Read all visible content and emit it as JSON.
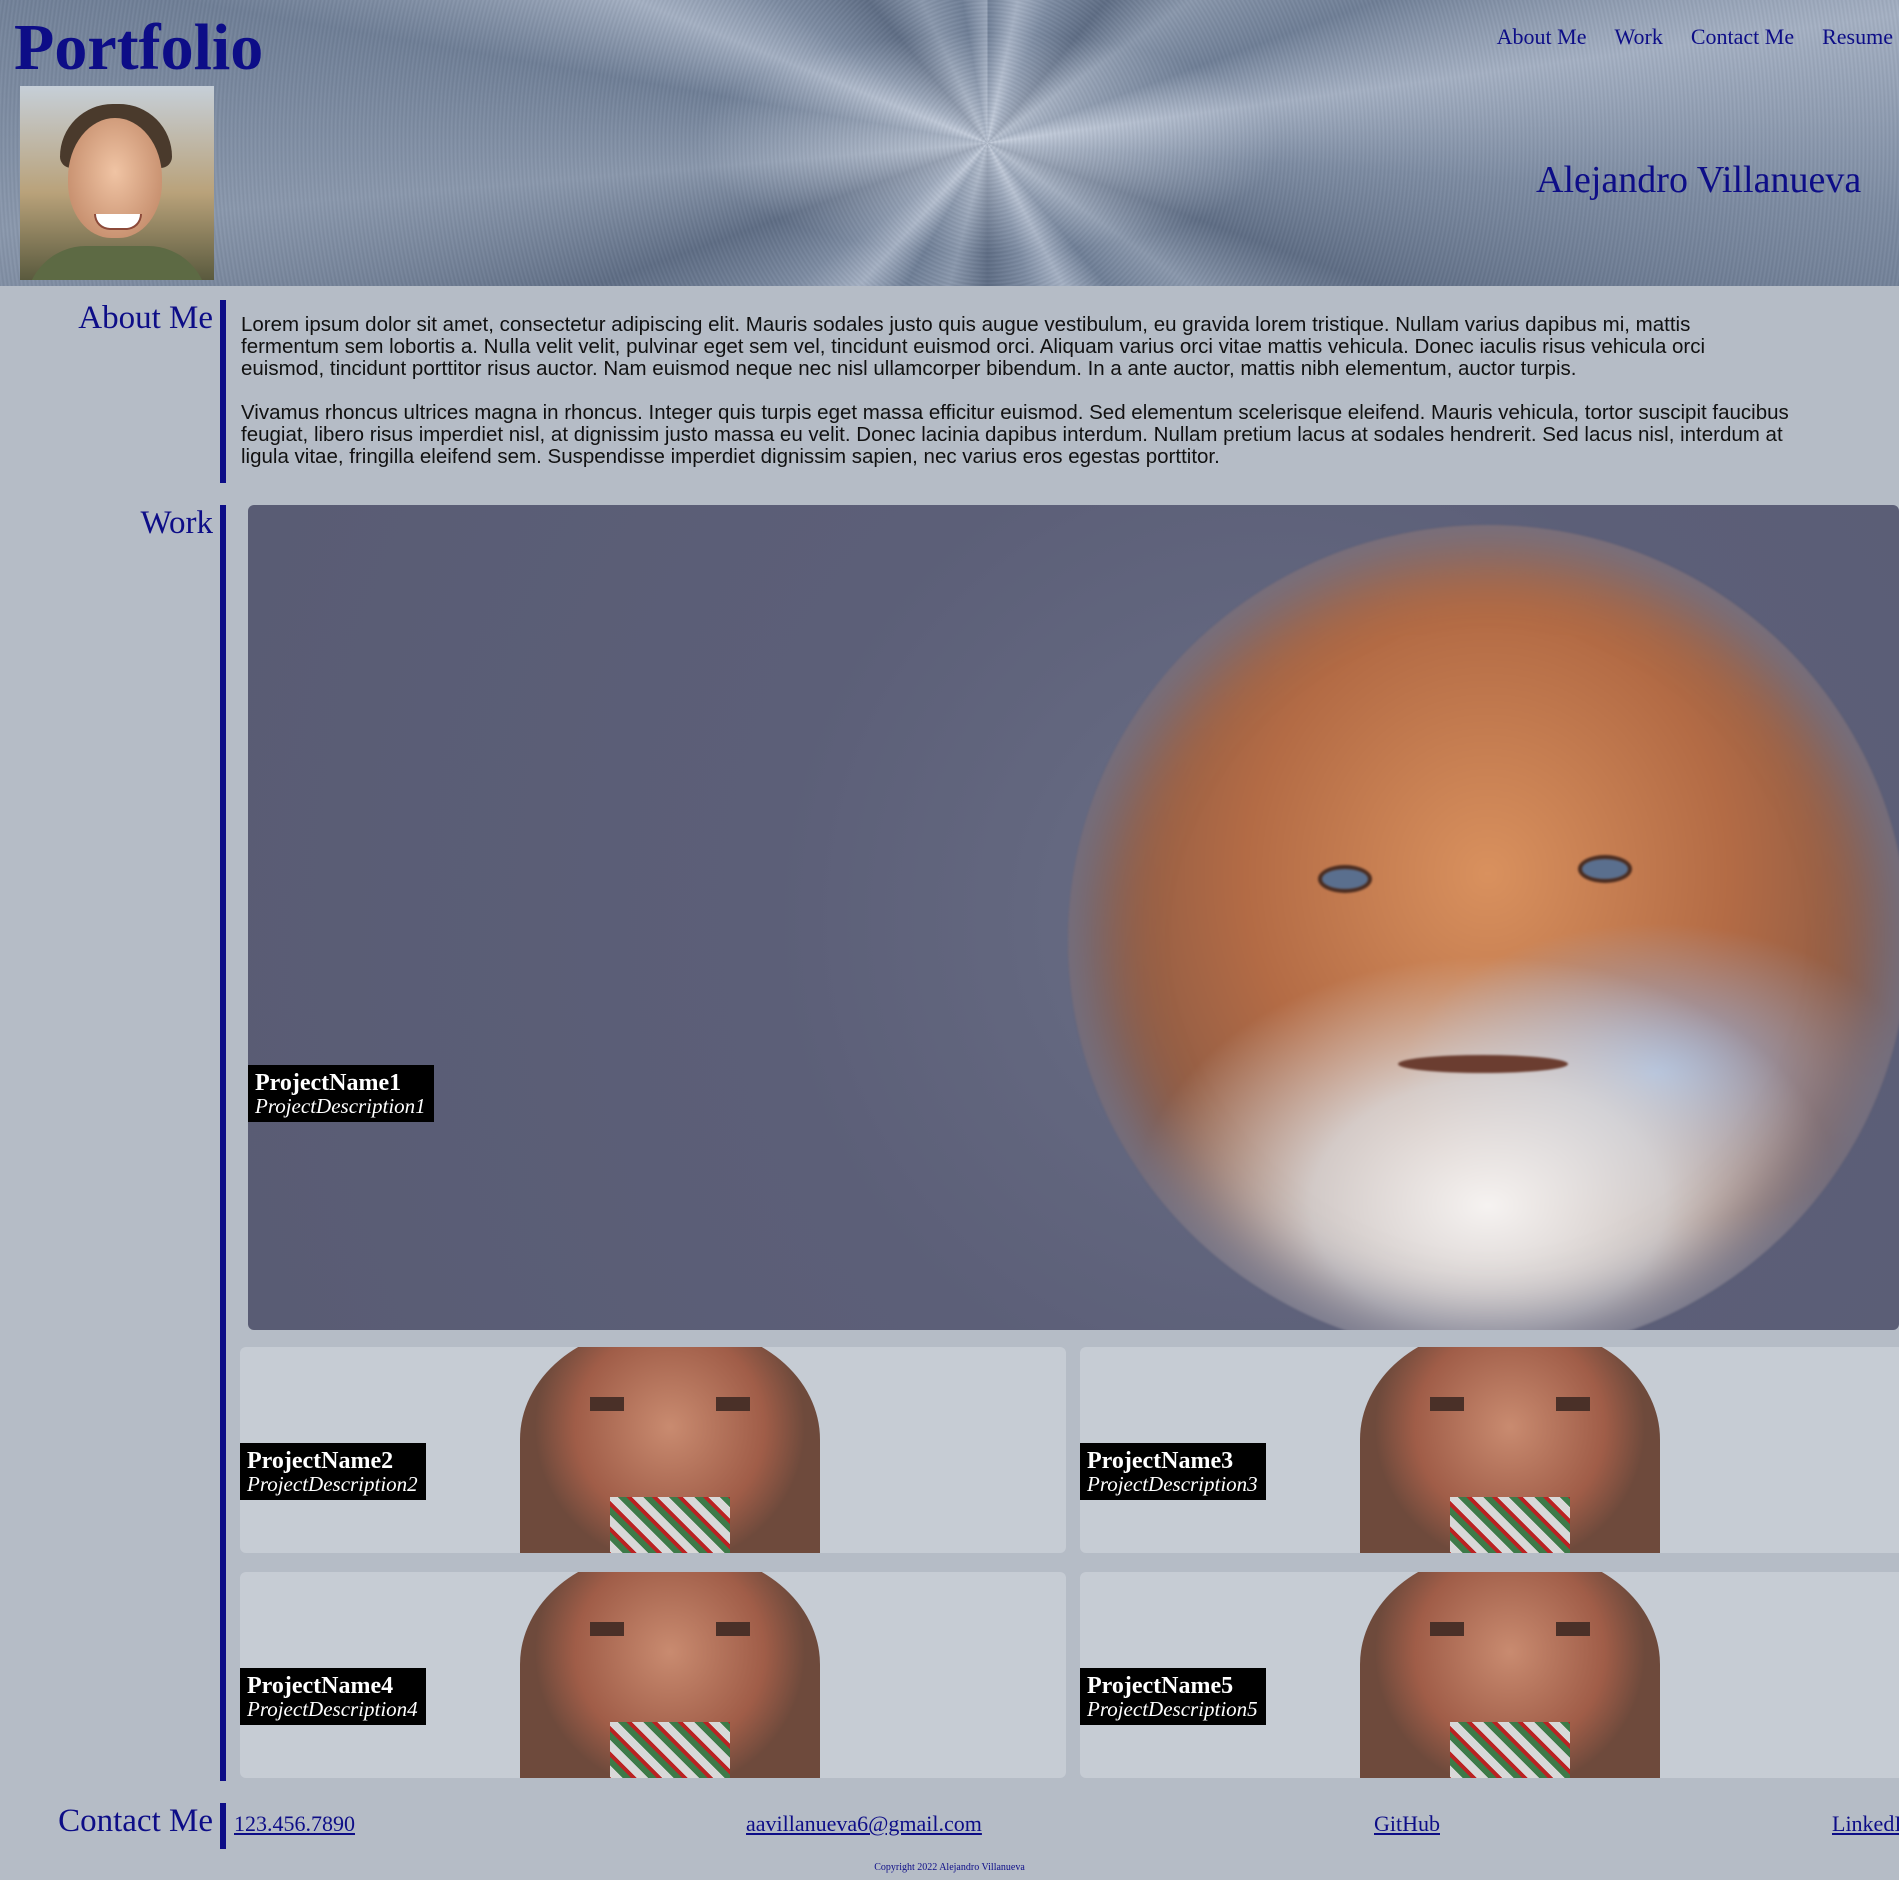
{
  "header": {
    "site_title": "Portfolio",
    "owner_name": "Alejandro Villanueva",
    "nav": [
      "About Me",
      "Work",
      "Contact Me",
      "Resume"
    ]
  },
  "about": {
    "heading": "About Me",
    "paragraphs": [
      [
        "Lorem ipsum dolor sit amet, consectetur adipiscing elit. Mauris sodales justo quis augue vestibulum, eu gravida lorem tristique. Nullam varius dapibus mi, mattis",
        "fermentum sem lobortis a. Nulla velit velit, pulvinar eget sem vel, tincidunt euismod orci. Aliquam varius orci vitae mattis vehicula. Donec iaculis risus vehicula orci",
        "euismod, tincidunt porttitor risus auctor. Nam euismod neque nec nisl ullamcorper bibendum. In a ante auctor, mattis nibh elementum, auctor turpis."
      ],
      [
        "Vivamus rhoncus ultrices magna in rhoncus. Integer quis turpis eget massa efficitur euismod. Sed elementum scelerisque eleifend. Mauris vehicula, tortor suscipit faucibus",
        "feugiat, libero risus imperdiet nisl, at dignissim justo massa eu velit. Donec lacinia dapibus interdum. Nullam pretium lacus at sodales hendrerit. Sed lacus nisl, interdum at",
        "ligula vitae, fringilla eleifend sem. Suspendisse imperdiet dignissim sapien, nec varius eros egestas porttitor."
      ]
    ]
  },
  "work": {
    "heading": "Work",
    "projects": [
      {
        "name": "ProjectName1",
        "description": "ProjectDescription1"
      },
      {
        "name": "ProjectName2",
        "description": "ProjectDescription2"
      },
      {
        "name": "ProjectName3",
        "description": "ProjectDescription3"
      },
      {
        "name": "ProjectName4",
        "description": "ProjectDescription4"
      },
      {
        "name": "ProjectName5",
        "description": "ProjectDescription5"
      }
    ]
  },
  "contact": {
    "heading": "Contact Me",
    "phone": "123.456.7890",
    "email": "aavillanueva6@gmail.com",
    "github": "GitHub",
    "linkedin": "LinkedIn"
  },
  "footer": {
    "copyright": "Copyright 2022 Alejandro Villanueva"
  },
  "colors": {
    "accent": "#0d0d87",
    "page_background": "#b5bcc6",
    "caption_background": "#000000"
  }
}
